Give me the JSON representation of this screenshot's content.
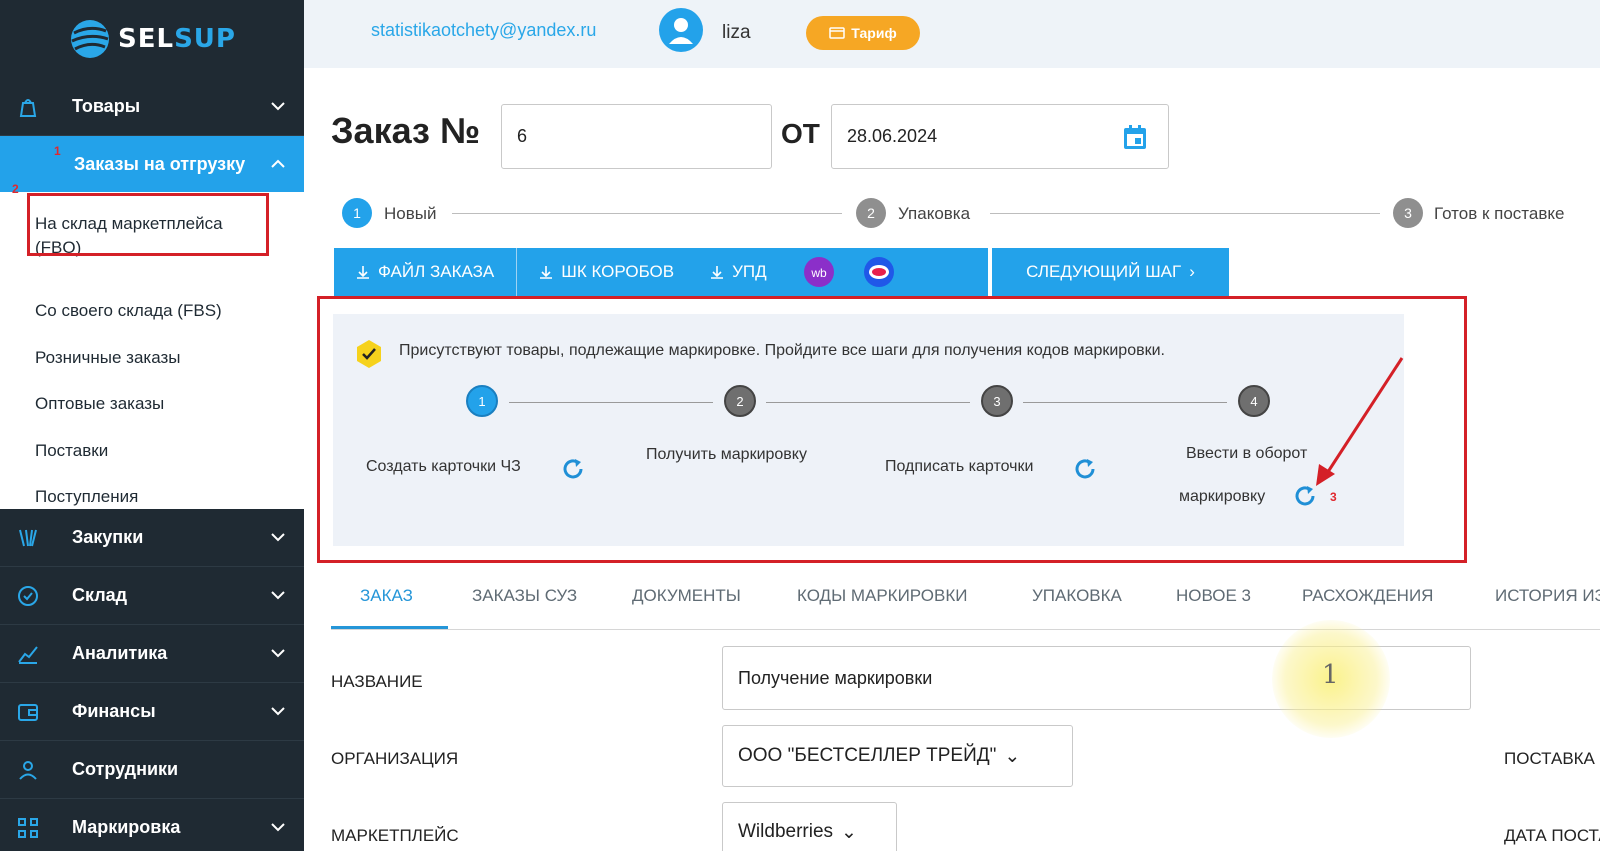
{
  "brand": {
    "name_part1": "SEL",
    "name_part2": "SUP"
  },
  "sidebar": {
    "menu_top": {
      "label": "Товары"
    },
    "active": {
      "label": "Заказы на отгрузку"
    },
    "sub_items": [
      {
        "label": "На склад маркетплейса (FBO)"
      },
      {
        "label": "Со своего склада (FBS)"
      },
      {
        "label": "Розничные заказы"
      },
      {
        "label": "Оптовые заказы"
      },
      {
        "label": "Поставки"
      },
      {
        "label": "Поступления"
      }
    ],
    "menu_bottom": [
      {
        "label": "Закупки"
      },
      {
        "label": "Склад"
      },
      {
        "label": "Аналитика"
      },
      {
        "label": "Финансы"
      },
      {
        "label": "Сотрудники"
      },
      {
        "label": "Маркировка"
      }
    ]
  },
  "annotations": {
    "n1": "1",
    "n2": "2",
    "n3": "3",
    "cursor": "1"
  },
  "header": {
    "email": "statistikaotchety@yandex.ru",
    "username": "liza",
    "tariff": "Тариф"
  },
  "order": {
    "title": "Заказ №",
    "number": "6",
    "from_label": "ОТ",
    "date": "28.06.2024"
  },
  "steps": [
    {
      "num": "1",
      "label": "Новый"
    },
    {
      "num": "2",
      "label": "Упаковка"
    },
    {
      "num": "3",
      "label": "Готов к поставке"
    }
  ],
  "actions": {
    "file": "ФАЙЛ ЗАКАЗА",
    "boxes": "ШК КОРОБОВ",
    "upd": "УПД",
    "next": "СЛЕДУЮЩИЙ ШАГ"
  },
  "marking": {
    "notice": "Присутствуют товары, подлежащие маркировке. Пройдите все шаги для получения кодов маркировки.",
    "steps": [
      {
        "num": "1",
        "label": "Создать карточки ЧЗ"
      },
      {
        "num": "2",
        "label": "Получить маркировку"
      },
      {
        "num": "3",
        "label": "Подписать карточки"
      },
      {
        "num": "4",
        "label_line1": "Ввести в оборот",
        "label_line2": "маркировку"
      }
    ]
  },
  "tabs": [
    "ЗАКАЗ",
    "ЗАКАЗЫ СУЗ",
    "ДОКУМЕНТЫ",
    "КОДЫ МАРКИРОВКИ",
    "УПАКОВКА",
    "НОВОЕ 3",
    "РАСХОЖДЕНИЯ",
    "ИСТОРИЯ ИЗМЕНЕНИЙ"
  ],
  "form": {
    "name_label": "НАЗВАНИЕ",
    "name_value": "Получение маркировки",
    "org_label": "ОРГАНИЗАЦИЯ",
    "org_value": "ООО \"БЕСТСЕЛЛЕР ТРЕЙД\"",
    "mp_label": "МАРКЕТПЛЕЙС",
    "mp_value": "Wildberries",
    "right_label1": "ПОСТАВКА",
    "right_label2": "ДАТА ПОСТАВКИ"
  },
  "colors": {
    "accent": "#23a2ea",
    "sidebar_bg": "#1f2a33",
    "tariff": "#f6a724",
    "annotation_red": "#d42027"
  }
}
